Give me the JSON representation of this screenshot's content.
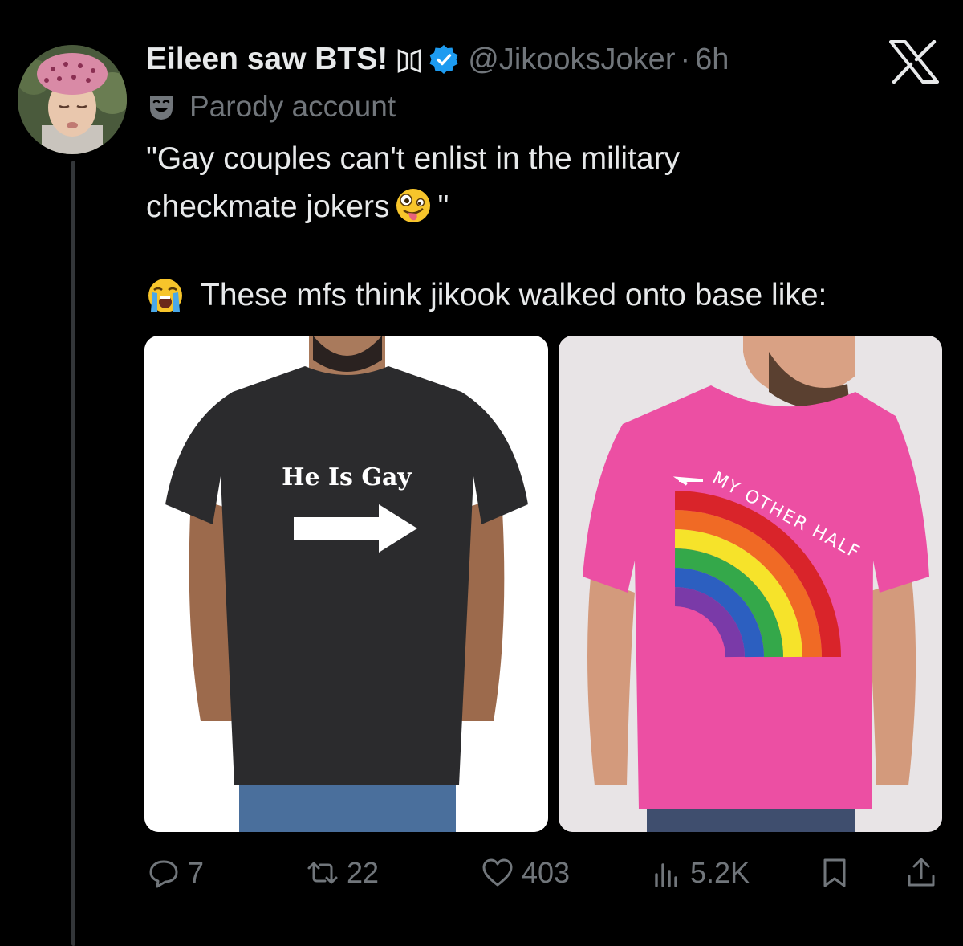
{
  "tweet": {
    "display_name": "Eileen saw BTS!",
    "handle": "@JikooksJoker",
    "dot": "·",
    "time": "6h",
    "account_label": "Parody account",
    "text_lines": [
      "\"Gay couples can't enlist in the military",
      "checkmate jokers",
      "\""
    ],
    "text_line3": "These mfs think jikook walked onto base like:",
    "emoji_line2": "zany-face-emoji",
    "emoji_line3": "loudly-crying-face-emoji"
  },
  "media": [
    {
      "shirt_text": "He Is Gay",
      "shirt_color": "#2b2b2d"
    },
    {
      "shirt_text": "MY OTHER HALF",
      "shirt_color": "#ec4fa3"
    }
  ],
  "actions": {
    "replies": "7",
    "reposts": "22",
    "likes": "403",
    "views": "5.2K"
  },
  "colors": {
    "background": "#000000",
    "text_primary": "#e7e9ea",
    "text_secondary": "#71767b",
    "verified_blue": "#1d9bf0"
  }
}
